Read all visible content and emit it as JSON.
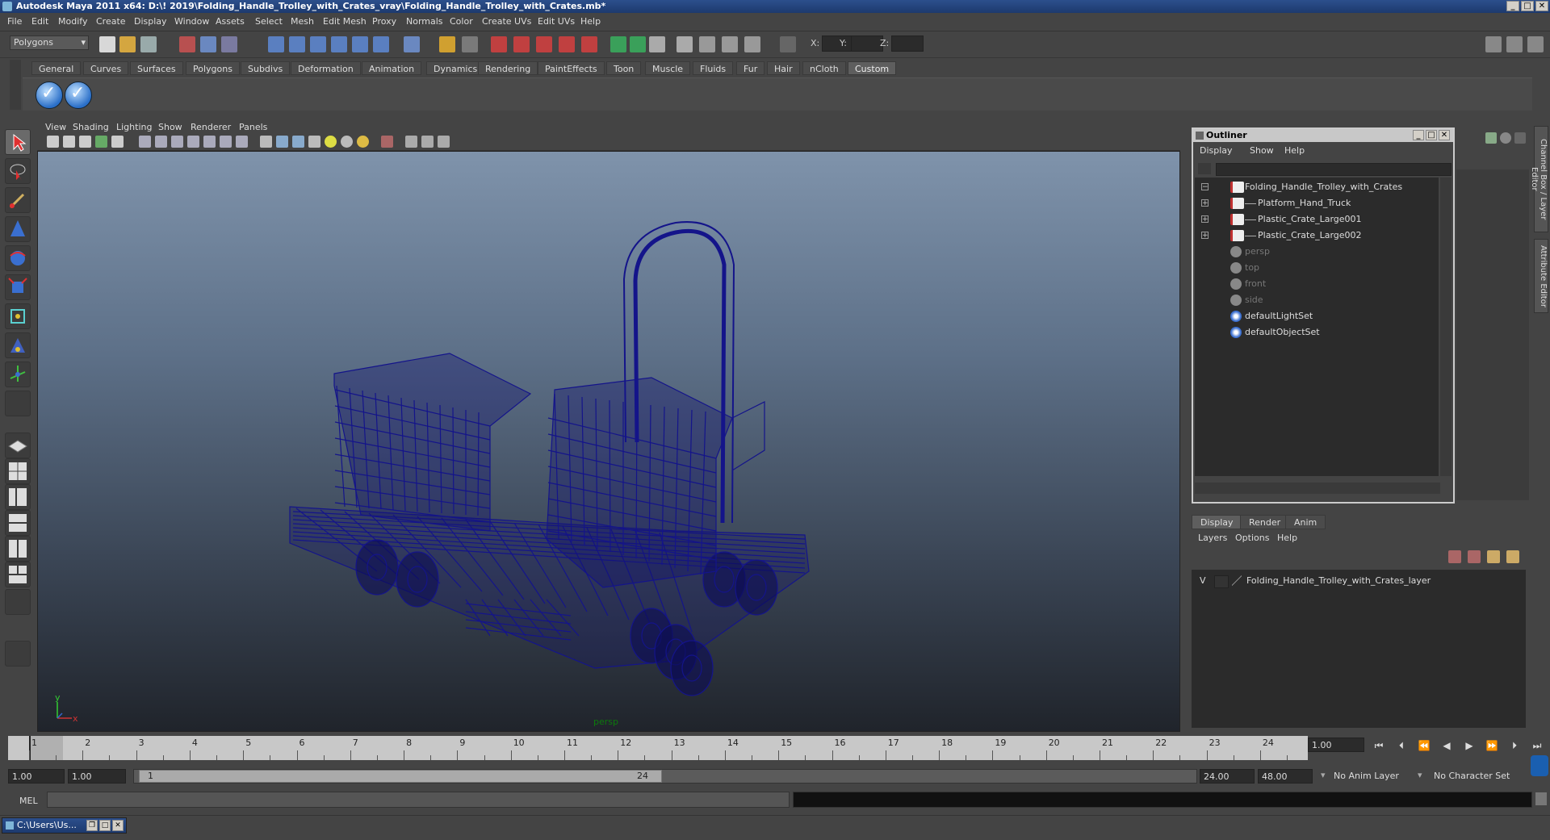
{
  "window": {
    "title": "Autodesk Maya 2011 x64: D:\\! 2019\\Folding_Handle_Trolley_with_Crates_vray\\Folding_Handle_Trolley_with_Crates.mb*",
    "controls": [
      "_",
      "□",
      "✕"
    ]
  },
  "menubar": [
    "File",
    "Edit",
    "Modify",
    "Create",
    "Display",
    "Window",
    "Assets",
    "Select",
    "Mesh",
    "Edit Mesh",
    "Proxy",
    "Normals",
    "Color",
    "Create UVs",
    "Edit UVs",
    "Help"
  ],
  "statusline": {
    "mode": "Polygons",
    "x_label": "X:",
    "y_label": "Y:",
    "z_label": "Z:"
  },
  "shelf": {
    "tabs": [
      "General",
      "Curves",
      "Surfaces",
      "Polygons",
      "Subdivs",
      "Deformation",
      "Animation",
      "Dynamics",
      "Rendering",
      "PaintEffects",
      "Toon",
      "Muscle",
      "Fluids",
      "Fur",
      "Hair",
      "nCloth",
      "Custom"
    ],
    "active_tab": "Custom",
    "buttons": [
      "checkmark-icon",
      "checkmark-icon"
    ]
  },
  "viewport": {
    "menu": [
      "View",
      "Shading",
      "Lighting",
      "Show",
      "Renderer",
      "Panels"
    ],
    "camera": "persp",
    "axis_y": "y",
    "axis_x": "x",
    "wire_color": "#14148a"
  },
  "outliner": {
    "title": "Outliner",
    "menu": [
      "Display",
      "Show",
      "Help"
    ],
    "items": [
      {
        "label": "Folding_Handle_Trolley_with_Crates",
        "type": "mesh",
        "indent": 0,
        "expand": "−",
        "dim": false
      },
      {
        "label": "Platform_Hand_Truck",
        "type": "mesh",
        "indent": 1,
        "expand": "+",
        "dim": false
      },
      {
        "label": "Plastic_Crate_Large001",
        "type": "mesh",
        "indent": 1,
        "expand": "+",
        "dim": false
      },
      {
        "label": "Plastic_Crate_Large002",
        "type": "mesh",
        "indent": 1,
        "expand": "+",
        "dim": false
      },
      {
        "label": "persp",
        "type": "camera",
        "indent": 0,
        "expand": "",
        "dim": true
      },
      {
        "label": "top",
        "type": "camera",
        "indent": 0,
        "expand": "",
        "dim": true
      },
      {
        "label": "front",
        "type": "camera",
        "indent": 0,
        "expand": "",
        "dim": true
      },
      {
        "label": "side",
        "type": "camera",
        "indent": 0,
        "expand": "",
        "dim": true
      },
      {
        "label": "defaultLightSet",
        "type": "set",
        "indent": 0,
        "expand": "",
        "dim": false
      },
      {
        "label": "defaultObjectSet",
        "type": "set",
        "indent": 0,
        "expand": "",
        "dim": false
      }
    ]
  },
  "right_tabs": [
    "Channel Box / Layer Editor",
    "Attribute Editor"
  ],
  "layer_editor": {
    "tabs": [
      "Display",
      "Render",
      "Anim"
    ],
    "active_tab": "Display",
    "menu": [
      "Layers",
      "Options",
      "Help"
    ],
    "layers": [
      {
        "visible": "V",
        "name": "Folding_Handle_Trolley_with_Crates_layer"
      }
    ]
  },
  "timeline": {
    "start": 1,
    "end": 24,
    "current_frame": "1.00",
    "labels": [
      "1",
      "2",
      "3",
      "4",
      "5",
      "6",
      "7",
      "8",
      "9",
      "10",
      "11",
      "12",
      "13",
      "14",
      "15",
      "16",
      "17",
      "18",
      "19",
      "20",
      "21",
      "22",
      "23",
      "24"
    ]
  },
  "range": {
    "start_time": "1.00",
    "playback_start": "1.00",
    "slider_start": "1",
    "slider_end": "24",
    "playback_end": "24.00",
    "end_time": "48.00",
    "anim_layer": "No Anim Layer",
    "character_set": "No Character Set"
  },
  "command_line": {
    "label": "MEL"
  },
  "taskbar": {
    "item": "C:\\Users\\Us..."
  }
}
